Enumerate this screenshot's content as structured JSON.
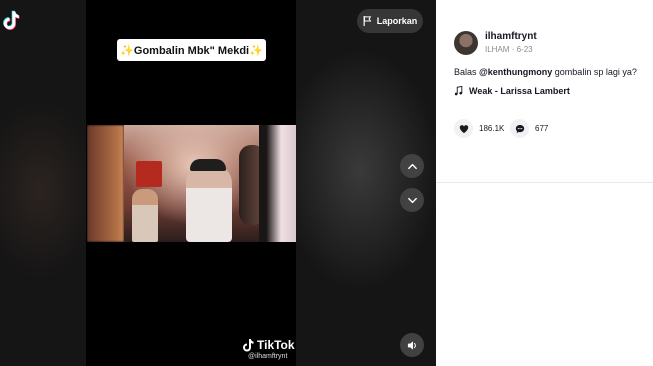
{
  "player": {
    "report_label": "Laporkan",
    "caption": "✨Gombalin Mbk\" Mekdi✨",
    "watermark_brand": "TikTok",
    "watermark_user": "@ilhamftrynt"
  },
  "author": {
    "username": "ilhamftrynt",
    "display_name": "ILHAM",
    "date": "6-23"
  },
  "description": {
    "prefix": "Balas ",
    "mention": "@kenthungmony",
    "suffix": " gombalin sp lagi ya?"
  },
  "music": {
    "title": "Weak - Larissa Lambert"
  },
  "stats": {
    "likes": "186.1K",
    "comments": "677"
  },
  "icons": {
    "app": "tiktok-icon",
    "report": "flag-icon",
    "prev": "chevron-up-icon",
    "next": "chevron-down-icon",
    "volume": "speaker-icon",
    "music": "music-note-icon",
    "like": "heart-icon",
    "comment": "comment-icon"
  },
  "colors": {
    "stage_bg": "#121212",
    "panel_bg": "#ffffff",
    "text_primary": "#161823",
    "text_secondary": "#8a8b91"
  }
}
